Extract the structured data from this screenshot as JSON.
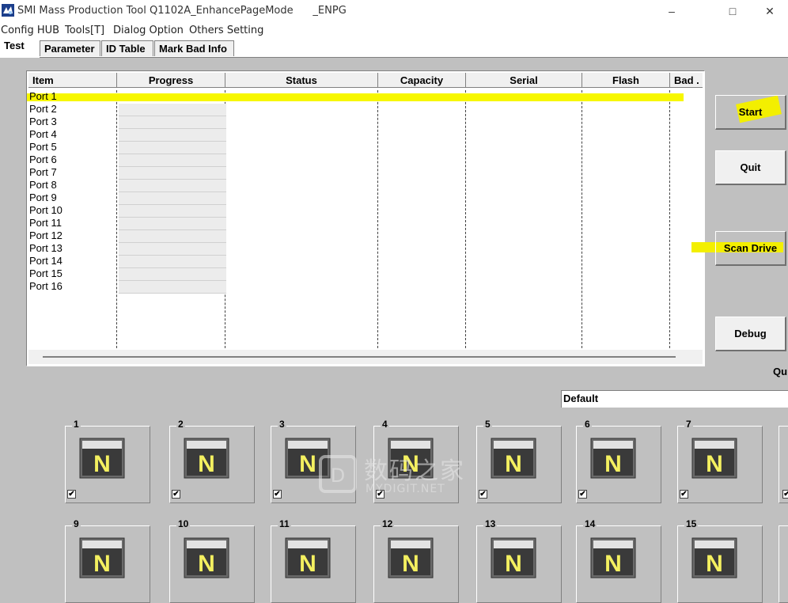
{
  "window": {
    "title": "SMI Mass Production Tool Q1102A_EnhancePageMode      _ENPG",
    "controls": [
      "–",
      "□",
      "✕"
    ]
  },
  "menu": [
    "Config HUB",
    "Tools[T]",
    "Dialog Option",
    "Others Setting"
  ],
  "tabs": [
    "Test",
    "Parameter",
    "ID Table",
    "Mark Bad Info"
  ],
  "list": {
    "columns": [
      "Item",
      "Progress",
      "Status",
      "Capacity",
      "Serial",
      "Flash",
      "Bad ."
    ],
    "rows": [
      "Port 1",
      "Port 2",
      "Port 3",
      "Port 4",
      "Port 5",
      "Port 6",
      "Port 7",
      "Port 8",
      "Port 9",
      "Port 10",
      "Port 11",
      "Port 12",
      "Port 13",
      "Port 14",
      "Port 15",
      "Port 16"
    ]
  },
  "buttons": {
    "start": "Start",
    "quit": "Quit",
    "scan_drive": "Scan Drive",
    "debug": "Debug"
  },
  "qu_label": "Qu",
  "profile_value": "Default",
  "drive_slots": {
    "row1": [
      "1",
      "2",
      "3",
      "4",
      "5",
      "6",
      "7"
    ],
    "row2": [
      "9",
      "10",
      "11",
      "12",
      "13",
      "14",
      "15"
    ],
    "letter": "N",
    "checkbox_mark": "✔"
  },
  "watermark": {
    "big": "数码之家",
    "small": "MYDIGIT.NET"
  },
  "colors": {
    "highlight": "#f7f700",
    "drive_letter": "#f4f060",
    "background": "#c0c0c0"
  }
}
